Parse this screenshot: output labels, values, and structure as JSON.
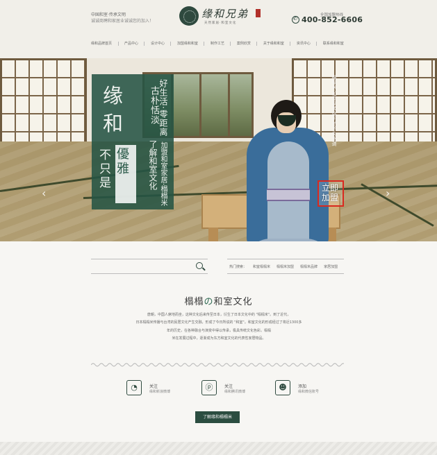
{
  "header": {
    "tagline_line1": "中国和室·传承文明",
    "tagline_line2": "诚诚商聘和家居业诚诚您的加入！",
    "logo_text": "缘和兄弟",
    "logo_subtitle": "天然家居·和室文化",
    "hotline_label": "全国加盟热线",
    "hotline": "400-852-6606"
  },
  "nav": {
    "items": [
      "缘和品牌首页",
      "产品中心",
      "设计中心",
      "加盟缘和和室",
      "制作工艺",
      "案例欣赏",
      "关于缘和和室",
      "资讯中心",
      "联系缘和和室"
    ]
  },
  "banner": {
    "title": "缘和",
    "sub_left": "不只是",
    "sub_right": "優雅",
    "vert_1": "好生活·零距离",
    "vert_2": "古朴恬淡",
    "vert_3": "加盟和室家居·榻榻米",
    "vert_4": "了解和室文化",
    "right_text": "榻榻米·和室家居·简约而不失格调",
    "join_cta": "立即加盟"
  },
  "search": {
    "placeholder": "",
    "hot_label": "热门搜索：",
    "hot_items": [
      "和室榻榻米",
      "榻榻米加盟",
      "榻榻米品牌",
      "家居加盟"
    ]
  },
  "culture": {
    "title_part1": "榻榻",
    "title_accent": "の",
    "title_part2": "和室文化",
    "lines": [
      "唐朝，中国人席地而坐，这种文化后来传至日本，衍生了日本文化中的 \"榻榻米\"。到了近代，",
      "日本榻榻米传播与台湾的民居文化产生交融，形成了今日所说的 \"和室\"。和室文化的形成经过了将近1300多",
      "年的历史，在各种融合与演变中得以传承，极具传统文化色彩。榻榻",
      "米在发展过程中，逐渐成为东方和室文化的代表性家居物品。"
    ]
  },
  "features": [
    {
      "icon": "wechat-icon",
      "title": "关注",
      "desc": "缘和新浪微博"
    },
    {
      "icon": "tencent-icon",
      "title": "关注",
      "desc": "缘和腾讯微博"
    },
    {
      "icon": "chat-icon",
      "title": "添加",
      "desc": "缘和微信账号"
    }
  ],
  "cta": {
    "label": "了解缘和榻榻米"
  },
  "colors": {
    "brand_green": "#2b4d40",
    "accent_red": "#d9291f"
  }
}
